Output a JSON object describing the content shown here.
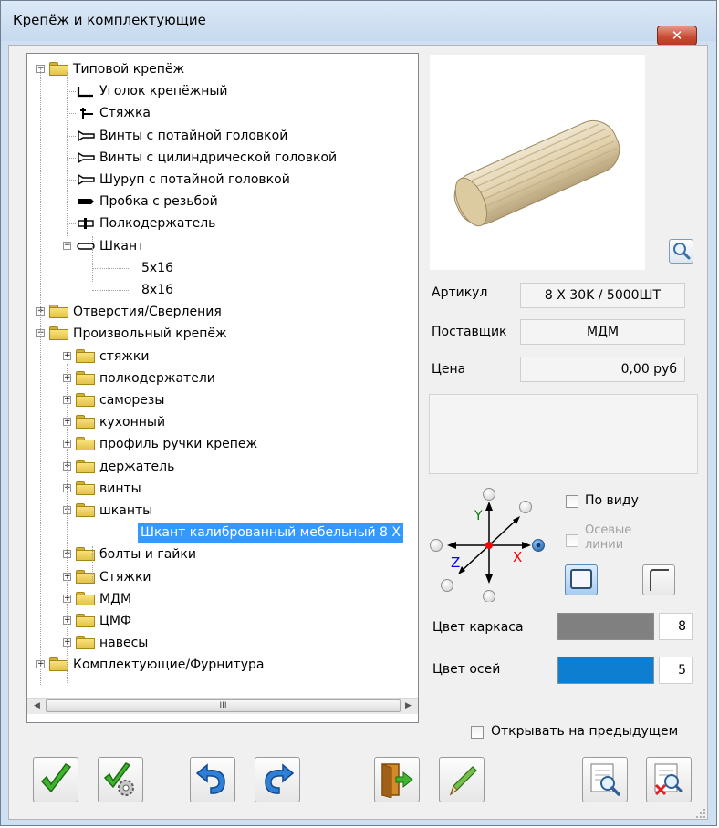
{
  "window": {
    "title": "Крепёж и комплектующие",
    "close_symbol": "✕"
  },
  "tree": {
    "items": [
      {
        "label": "Типовой крепёж",
        "icon": "folder-open-icon"
      },
      {
        "label": "Уголок крепёжный",
        "icon": "corner-bracket-icon"
      },
      {
        "label": "Стяжка",
        "icon": "tie-icon"
      },
      {
        "label": "Винты с потайной головкой",
        "icon": "countersunk-screw-icon"
      },
      {
        "label": "Винты с цилиндрической головкой",
        "icon": "cylinder-screw-icon"
      },
      {
        "label": "Шуруп с потайной головкой",
        "icon": "wood-screw-icon"
      },
      {
        "label": "Пробка с резьбой",
        "icon": "threaded-plug-icon"
      },
      {
        "label": "Полкодержатель",
        "icon": "shelf-support-icon"
      },
      {
        "label": "Шкант",
        "icon": "dowel-icon"
      },
      {
        "label": "5x16",
        "icon": ""
      },
      {
        "label": "8x16",
        "icon": ""
      },
      {
        "label": "Отверстия/Сверления",
        "icon": "folder-icon"
      },
      {
        "label": "Произвольный крепёж",
        "icon": "folder-open-icon"
      },
      {
        "label": "стяжки",
        "icon": "folder-icon"
      },
      {
        "label": "полкодержатели",
        "icon": "folder-icon"
      },
      {
        "label": "саморезы",
        "icon": "folder-icon"
      },
      {
        "label": "кухонный",
        "icon": "folder-icon"
      },
      {
        "label": "профиль ручки крепеж",
        "icon": "folder-icon"
      },
      {
        "label": "держатель",
        "icon": "folder-icon"
      },
      {
        "label": "винты",
        "icon": "folder-icon"
      },
      {
        "label": "шканты",
        "icon": "folder-open-icon"
      },
      {
        "label": "Шкант калиброванный мебельный 8 X",
        "icon": "",
        "selected": true
      },
      {
        "label": "болты и гайки",
        "icon": "folder-icon"
      },
      {
        "label": "Стяжки",
        "icon": "folder-icon"
      },
      {
        "label": "МДМ",
        "icon": "folder-icon"
      },
      {
        "label": "ЦМФ",
        "icon": "folder-icon"
      },
      {
        "label": "навесы",
        "icon": "folder-icon"
      },
      {
        "label": "Комплектующие/Фурнитура",
        "icon": "folder-icon"
      }
    ],
    "scroll_thumb_label": "III"
  },
  "details": {
    "article_label": "Артикул",
    "article_value": "8 X 30K / 5000ШТ",
    "supplier_label": "Поставщик",
    "supplier_value": "МДМ",
    "price_label": "Цена",
    "price_value": "0,00 руб"
  },
  "view": {
    "by_view_label": "По виду",
    "axis_lines_label_1": "Осевые",
    "axis_lines_label_2": "линии",
    "axis_x": "X",
    "axis_y": "Y",
    "axis_z": "Z"
  },
  "colors": {
    "frame_label": "Цвет каркаса",
    "frame_value": "8",
    "frame_color": "#808080",
    "axes_label": "Цвет осей",
    "axes_value": "5",
    "axes_color": "#0e7fd0"
  },
  "open_prev_label": "Открывать на предыдущем",
  "toolbar": {
    "ok": "check-icon",
    "ok_settings": "check-gear-icon",
    "undo": "undo-icon",
    "redo": "redo-icon",
    "exit": "exit-door-icon",
    "edit": "pencil-icon",
    "preview": "preview-icon",
    "delete_preview": "delete-preview-icon"
  }
}
